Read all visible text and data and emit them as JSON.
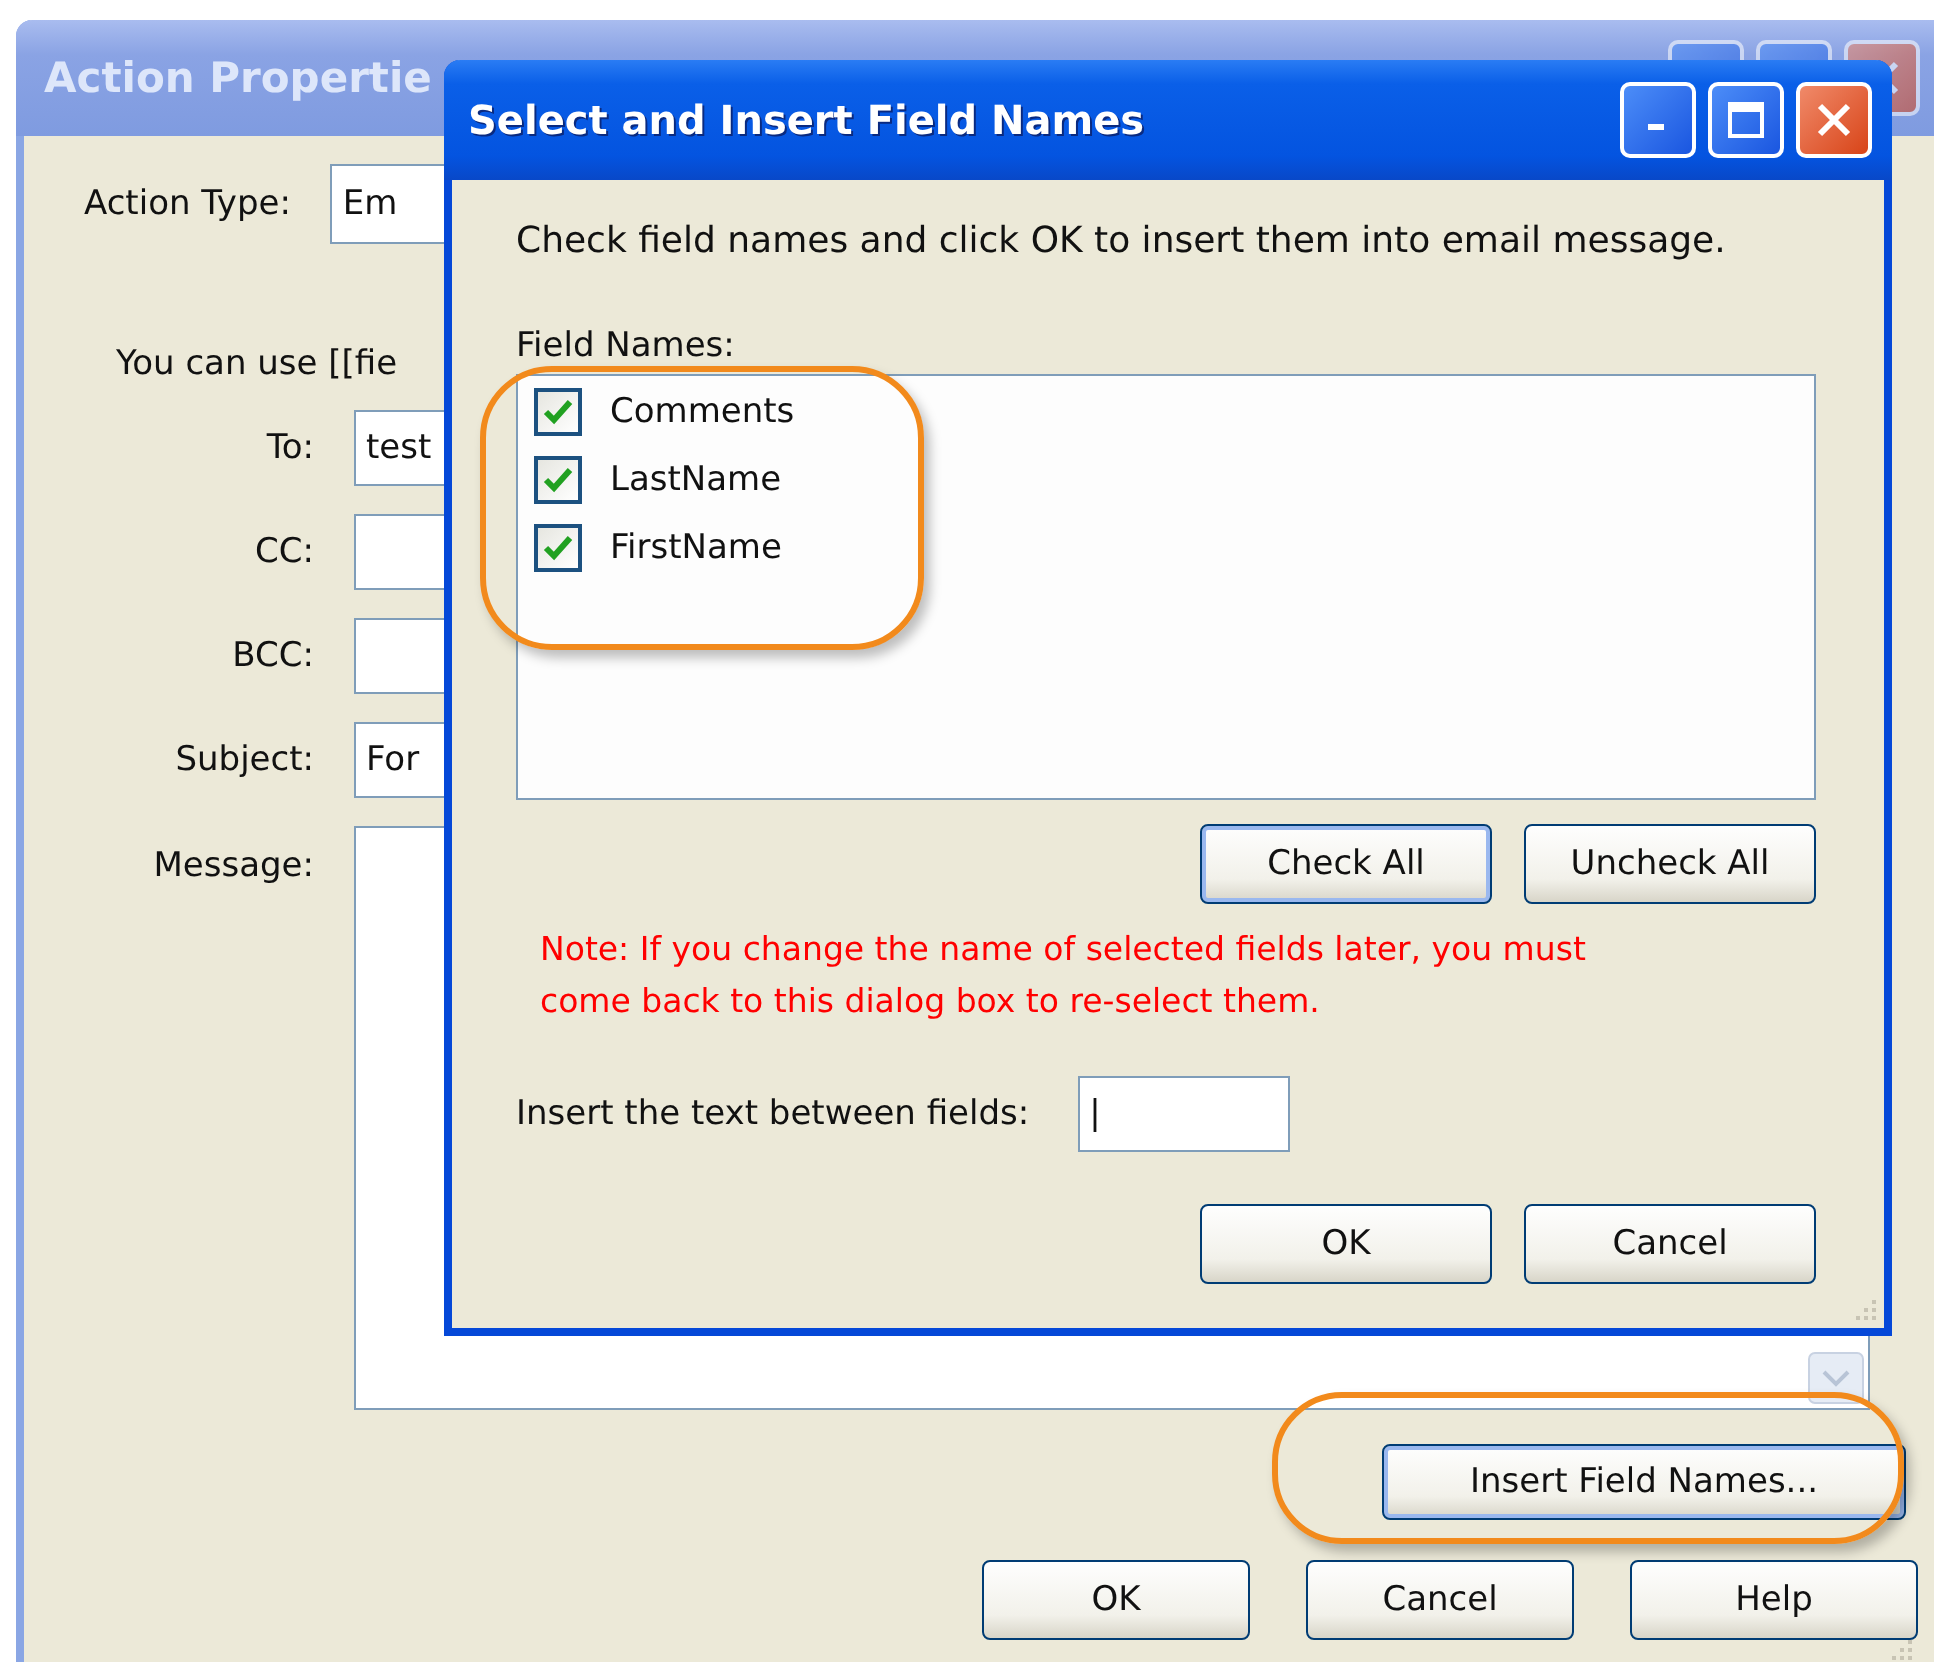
{
  "background_window": {
    "title": "Action Propertie",
    "action_type": {
      "label": "Action Type:",
      "value": "Em"
    },
    "hint": "You can use [[fie",
    "fields": [
      {
        "label": "To:",
        "value": "test"
      },
      {
        "label": "CC:"
      },
      {
        "label": "BCC:"
      },
      {
        "label": "Subject:",
        "value": "For"
      }
    ],
    "message": {
      "label": "Message:"
    },
    "insert_button": "Insert Field Names...",
    "buttons": [
      "OK",
      "Cancel",
      "Help"
    ]
  },
  "dialog": {
    "title": "Select and Insert Field Names",
    "instruction": "Check field names and click OK to insert them into email message.",
    "list_label": "Field Names:",
    "items": [
      {
        "label": "Comments",
        "checked": true
      },
      {
        "label": "LastName",
        "checked": true
      },
      {
        "label": "FirstName",
        "checked": true
      }
    ],
    "list_buttons": [
      "Check All",
      "Uncheck All"
    ],
    "note": "Note: If you change the name of selected fields later, you must come back to this dialog box to re-select them.",
    "separator": {
      "label": "Insert the text between fields:",
      "value": "|"
    },
    "buttons": [
      "OK",
      "Cancel"
    ]
  }
}
